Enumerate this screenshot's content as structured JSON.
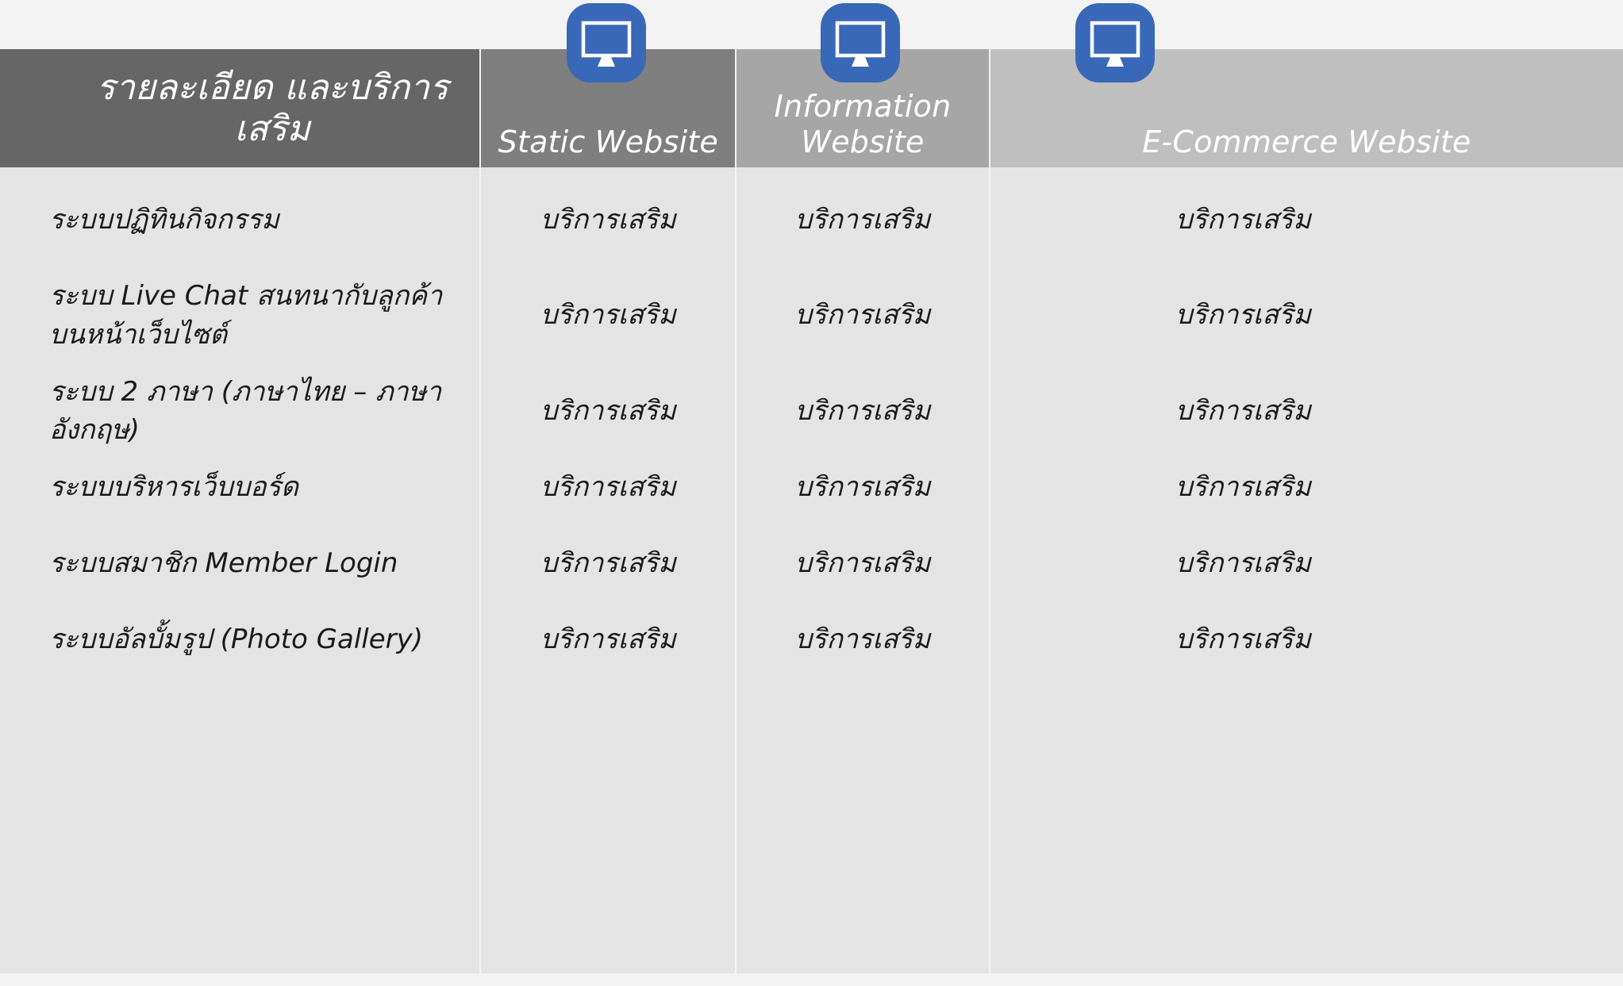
{
  "theme": {
    "page_background": "#f3f3f3",
    "header_feature_bg": "#666666",
    "header_static_bg": "#7f7f7f",
    "header_info_bg": "#a6a6a6",
    "header_ecommerce_bg": "#bfbfbf",
    "cell_bg": "#e4e4e4",
    "divider": "#ffffff",
    "icon_blue": "#3a68b8",
    "header_text": "#ffffff",
    "body_text": "#1a1a1a"
  },
  "table": {
    "feature_header": "รายละเอียด และบริการเสริม",
    "columns": [
      {
        "id": "static",
        "label": "Static\nWebsite",
        "icon": "monitor-icon"
      },
      {
        "id": "information",
        "label": "Information\nWebsite",
        "icon": "monitor-icon"
      },
      {
        "id": "ecommerce",
        "label": "E-Commerce\nWebsite",
        "icon": "monitor-icon"
      }
    ],
    "rows": [
      {
        "feature": "ระบบปฏิทินกิจกรรม",
        "static": "บริการเสริม",
        "information": "บริการเสริม",
        "ecommerce": "บริการเสริม"
      },
      {
        "feature": "ระบบ Live Chat สนทนากับลูกค้า\nบนหน้าเว็บไซต์",
        "static": "บริการเสริม",
        "information": "บริการเสริม",
        "ecommerce": "บริการเสริม"
      },
      {
        "feature": "ระบบ 2 ภาษา (ภาษาไทย – ภาษาอังกฤษ)",
        "static": "บริการเสริม",
        "information": "บริการเสริม",
        "ecommerce": "บริการเสริม"
      },
      {
        "feature": "ระบบบริหารเว็บบอร์ด",
        "static": "บริการเสริม",
        "information": "บริการเสริม",
        "ecommerce": "บริการเสริม"
      },
      {
        "feature": "ระบบสมาชิก Member Login",
        "static": "บริการเสริม",
        "information": "บริการเสริม",
        "ecommerce": "บริการเสริม"
      },
      {
        "feature": "ระบบอัลบั้มรูป (Photo Gallery)",
        "static": "บริการเสริม",
        "information": "บริการเสริม",
        "ecommerce": "บริการเสริม"
      }
    ]
  }
}
